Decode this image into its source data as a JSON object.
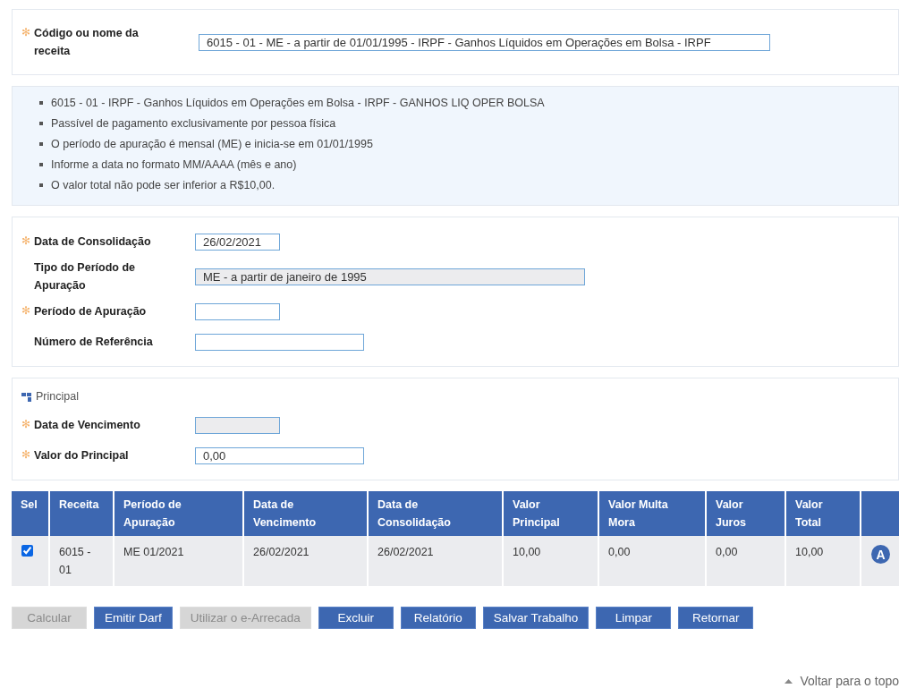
{
  "receita": {
    "label": "Código ou nome da receita",
    "required_mark": "✻",
    "value": "6015 - 01 - ME - a partir de 01/01/1995 - IRPF - Ganhos Líquidos em Operações em Bolsa - IRPF"
  },
  "info": [
    "6015 - 01 - IRPF - Ganhos Líquidos em Operações em Bolsa - IRPF - GANHOS LIQ OPER BOLSA",
    "Passível de pagamento exclusivamente por pessoa física",
    "O período de apuração é mensal (ME) e inicia-se em 01/01/1995",
    "Informe a data no formato MM/AAAA (mês e ano)",
    "O valor total não pode ser inferior a R$10,00."
  ],
  "dates": [
    {
      "label": "Data de Consolidação",
      "required_mark": "✻",
      "value": "26/02/2021",
      "disabled": false,
      "kind": "date"
    },
    {
      "label": "Tipo do Período de Apuração",
      "value": "ME - a partir de janeiro de 1995",
      "disabled": true,
      "kind": "select"
    },
    {
      "label": "Período de Apuração",
      "required_mark": "✻",
      "disabled": false,
      "kind": "date"
    },
    {
      "label": "Número de Referência",
      "disabled": false,
      "kind": "text"
    }
  ],
  "principal": {
    "title": "Principal",
    "fields": [
      {
        "label": "Data de Vencimento",
        "required_mark": "✻",
        "disabled": true,
        "kind": "date"
      },
      {
        "label": "Valor do Principal",
        "required_mark": "✻",
        "value": "0,00",
        "disabled": false,
        "kind": "text"
      }
    ]
  },
  "table": {
    "columns": [
      "Sel",
      "Receita",
      "Período de Apuração",
      "Data de Vencimento",
      "Data de Consolidação",
      "Valor Principal",
      "Valor Multa Mora",
      "Valor Juros",
      "Valor Total"
    ],
    "rows": [
      {
        "checked": true,
        "cells": [
          "",
          "6015 - 01",
          "ME 01/2021",
          "26/02/2021",
          "26/02/2021",
          "10,00",
          "0,00",
          "0,00",
          "10,00"
        ],
        "action": "A"
      }
    ]
  },
  "buttons": [
    {
      "label": "Calcular",
      "disabled": true
    },
    {
      "label": "Emitir Darf",
      "disabled": false
    },
    {
      "label": "Utilizar o e-Arrecada",
      "disabled": true
    },
    {
      "label": "Excluir",
      "disabled": false
    },
    {
      "label": "Relatório",
      "disabled": false
    },
    {
      "label": "Salvar Trabalho",
      "disabled": false
    },
    {
      "label": "Limpar",
      "disabled": false
    },
    {
      "label": "Retornar",
      "disabled": false
    }
  ],
  "back_to_top": "Voltar para o topo"
}
